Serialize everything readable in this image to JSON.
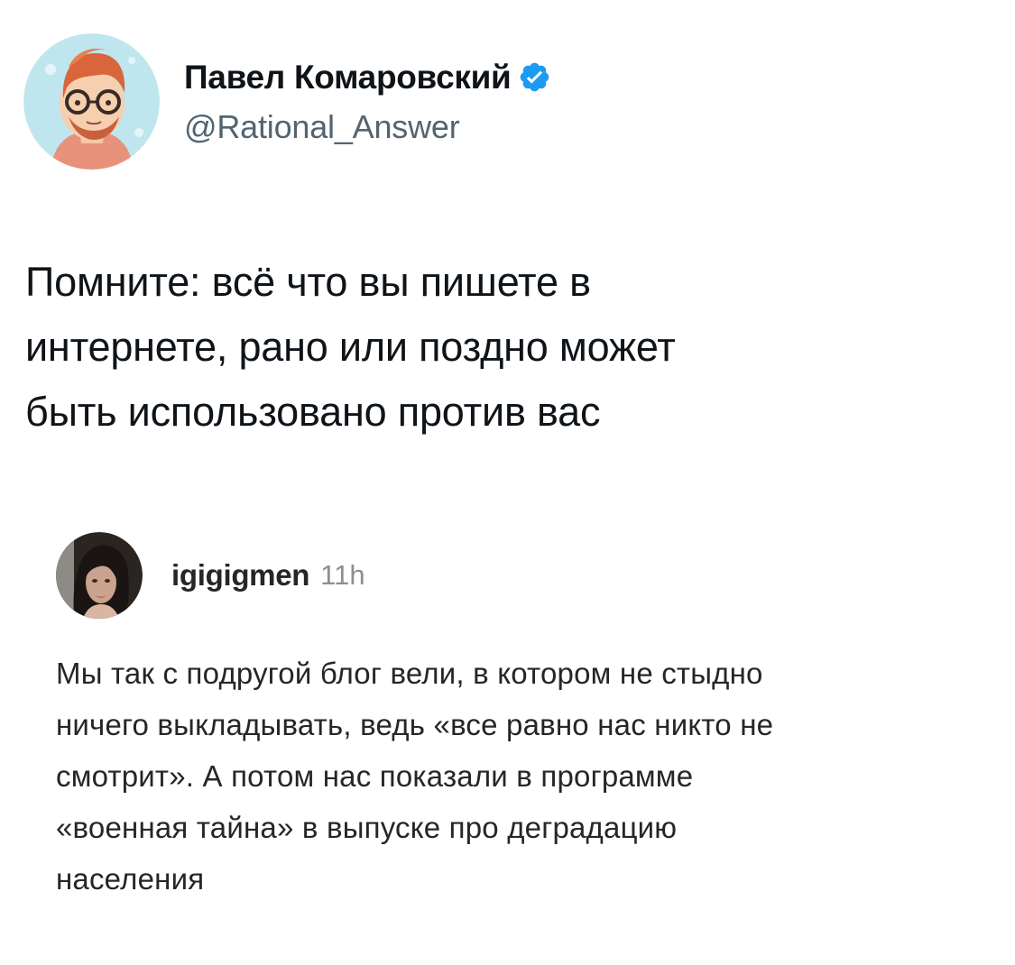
{
  "tweet": {
    "author": {
      "display_name": "Павел Комаровский",
      "handle": "@Rational_Answer",
      "verified_icon": "verified-badge-icon",
      "badge_color": "#1d9bf0"
    },
    "text_lines": [
      "Помните: всё что вы пишете в",
      "интернете, рано или поздно может",
      "быть использовано против вас"
    ]
  },
  "quoted_post": {
    "username": "igigigmen",
    "time": "11h",
    "text_lines": [
      "Мы так с подругой блог вели, в котором не стыдно",
      "ничего выкладывать, ведь «все равно нас никто не",
      "смотрит». А потом нас показали в программе",
      "«военная тайна» в выпуске про деградацию",
      "населения"
    ]
  }
}
